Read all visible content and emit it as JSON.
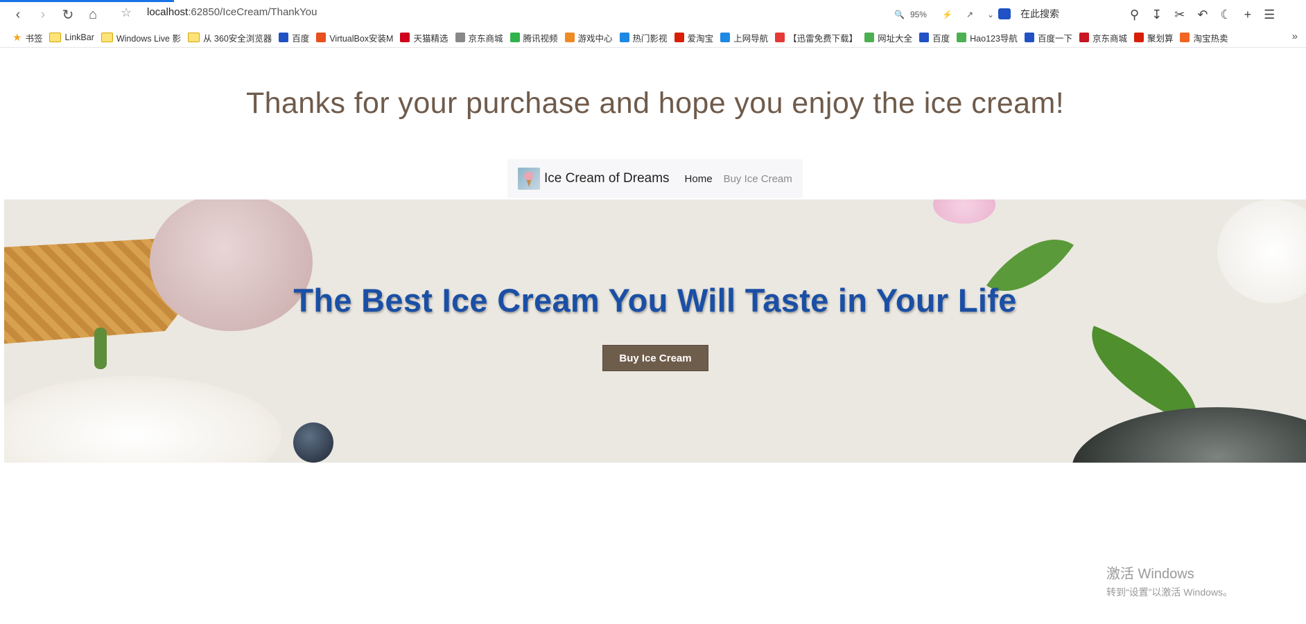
{
  "browser": {
    "url_host": "localhost",
    "url_rest": ":62850/IceCream/ThankYou",
    "zoom": "95%",
    "search_placeholder": "在此搜索"
  },
  "bookmarks": [
    {
      "label": "书签",
      "icon": "star-icon",
      "color": "#f5a623"
    },
    {
      "label": "LinkBar",
      "icon": "folder-icon",
      "color": "#ffe27a"
    },
    {
      "label": "Windows Live 影",
      "icon": "folder-icon",
      "color": "#ffe27a"
    },
    {
      "label": "从 360安全浏览器",
      "icon": "folder-icon",
      "color": "#ffe27a"
    },
    {
      "label": "百度",
      "icon": "baidu-icon",
      "color": "#2052c5"
    },
    {
      "label": "VirtualBox安装M",
      "icon": "c-icon",
      "color": "#e8501f"
    },
    {
      "label": "天猫精选",
      "icon": "tmall-icon",
      "color": "#d0021b"
    },
    {
      "label": "京东商城",
      "icon": "globe-icon",
      "color": "#888888"
    },
    {
      "label": "腾讯视频",
      "icon": "play-icon",
      "color": "#2fb34a"
    },
    {
      "label": "游戏中心",
      "icon": "game-icon",
      "color": "#f08a24"
    },
    {
      "label": "热门影视",
      "icon": "video-icon",
      "color": "#1e88e5"
    },
    {
      "label": "爱淘宝",
      "icon": "taobao-icon",
      "color": "#d81e06"
    },
    {
      "label": "上网导航",
      "icon": "nav-icon",
      "color": "#1e88e5"
    },
    {
      "label": "【迅雷免费下载】",
      "icon": "xunlei-icon",
      "color": "#e53935"
    },
    {
      "label": "网址大全",
      "icon": "hao-icon",
      "color": "#4caf50"
    },
    {
      "label": "百度",
      "icon": "baidu-icon",
      "color": "#2052c5"
    },
    {
      "label": "Hao123导航",
      "icon": "hao-icon",
      "color": "#4caf50"
    },
    {
      "label": "百度一下",
      "icon": "baidu-icon",
      "color": "#2052c5"
    },
    {
      "label": "京东商城",
      "icon": "jd-icon",
      "color": "#c91623"
    },
    {
      "label": "聚划算",
      "icon": "ju-icon",
      "color": "#d81e06"
    },
    {
      "label": "淘宝热卖",
      "icon": "taobao-icon",
      "color": "#f26522"
    }
  ],
  "page": {
    "thanks_message": "Thanks for your purchase and hope you enjoy the ice cream!",
    "navbar": {
      "brand": "Ice Cream of Dreams",
      "home": "Home",
      "buy": "Buy Ice Cream"
    },
    "hero": {
      "heading": "The Best Ice Cream You Will Taste in Your Life",
      "button": "Buy Ice Cream"
    }
  },
  "watermark": {
    "line1": "激活 Windows",
    "line2": "转到“设置”以激活 Windows。"
  }
}
